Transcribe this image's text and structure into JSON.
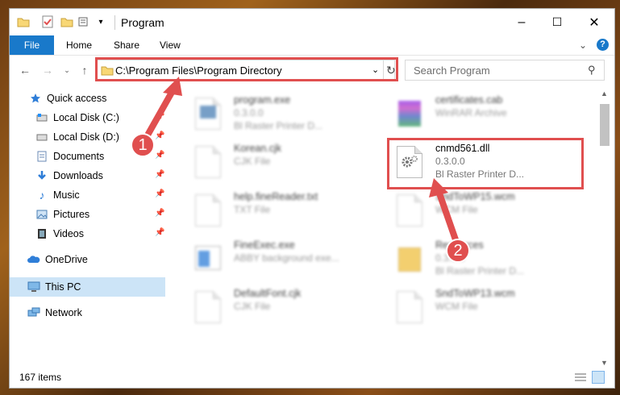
{
  "window": {
    "title": "Program",
    "controls": {
      "minimize": "–",
      "maximize": "☐",
      "close": "✕"
    }
  },
  "ribbon": {
    "tabs": [
      "File",
      "Home",
      "Share",
      "View"
    ]
  },
  "address": {
    "path": "C:\\Program Files\\Program Directory",
    "search_placeholder": "Search Program"
  },
  "nav": {
    "items": [
      {
        "label": "Quick access",
        "icon": "star-icon"
      },
      {
        "label": "Local Disk (C:)",
        "icon": "drive-icon"
      },
      {
        "label": "Local Disk (D:)",
        "icon": "drive-icon"
      },
      {
        "label": "Documents",
        "icon": "documents-icon"
      },
      {
        "label": "Downloads",
        "icon": "downloads-icon"
      },
      {
        "label": "Music",
        "icon": "music-icon"
      },
      {
        "label": "Pictures",
        "icon": "pictures-icon"
      },
      {
        "label": "Videos",
        "icon": "videos-icon"
      },
      {
        "label": "OneDrive",
        "icon": "cloud-icon"
      },
      {
        "label": "This PC",
        "icon": "computer-icon"
      },
      {
        "label": "Network",
        "icon": "network-icon"
      }
    ]
  },
  "files": [
    {
      "name": "program.exe",
      "l2": "0.3.0.0",
      "l3": "Bl Raster Printer D...",
      "blurred": true
    },
    {
      "name": "certificates.cab",
      "l2": "WinRAR Archive",
      "l3": "",
      "blurred": true
    },
    {
      "name": "Korean.cjk",
      "l2": "CJK File",
      "l3": "",
      "blurred": true
    },
    {
      "name": "cnmd561.dll",
      "l2": "0.3.0.0",
      "l3": "Bl Raster Printer D...",
      "blurred": false
    },
    {
      "name": "help.fineReader.txt",
      "l2": "TXT File",
      "l3": "",
      "blurred": true
    },
    {
      "name": "SndToWP15.wcm",
      "l2": "WCM File",
      "l3": "",
      "blurred": true
    },
    {
      "name": "FineExec.exe",
      "l2": "ABBY background exe...",
      "l3": "",
      "blurred": true
    },
    {
      "name": "Resources",
      "l2": "0.3.0.0",
      "l3": "Bl Raster Printer D...",
      "blurred": true
    },
    {
      "name": "DefaultFont.cjk",
      "l2": "CJK File",
      "l3": "",
      "blurred": true
    },
    {
      "name": "SndToWP13.wcm",
      "l2": "WCM File",
      "l3": "",
      "blurred": true
    }
  ],
  "status": {
    "count": "167 items"
  },
  "annotations": {
    "step1": "1",
    "step2": "2",
    "color": "#e04f4f"
  }
}
